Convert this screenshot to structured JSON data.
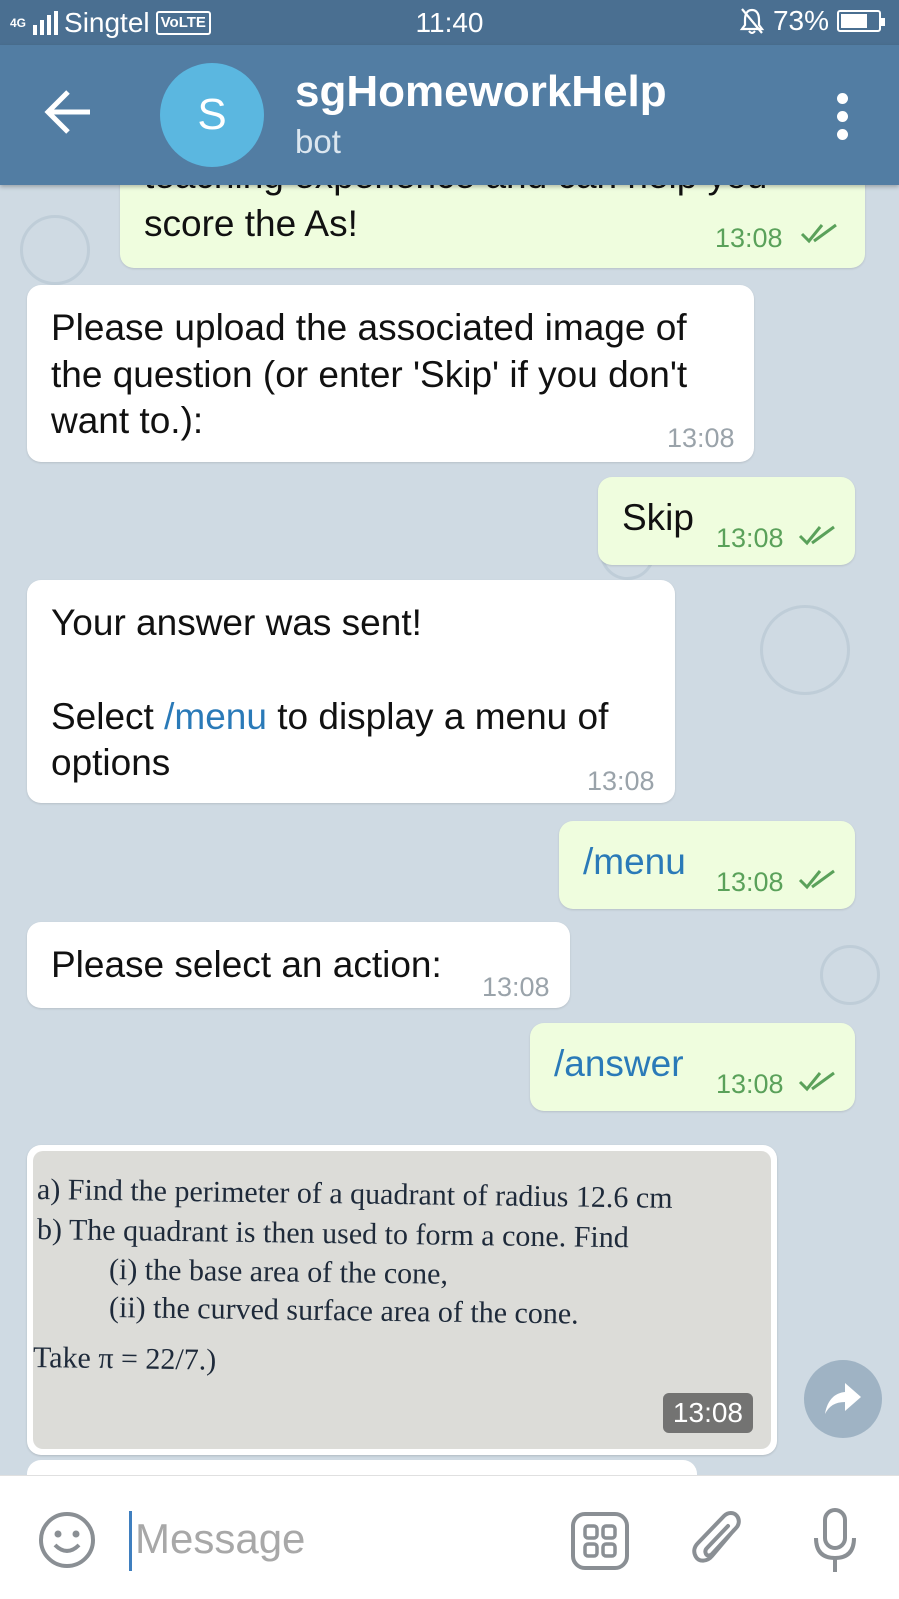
{
  "status_bar": {
    "network": "4G",
    "carrier": "Singtel",
    "volte": "VoLTE",
    "time": "11:40",
    "battery": "73%",
    "battery_level": 0.73
  },
  "header": {
    "avatar_letter": "S",
    "title": "sgHomeworkHelp",
    "subtitle": "bot",
    "colors": {
      "header": "#527da3",
      "status": "#4a6f91",
      "avatar": "#5bb7e0"
    }
  },
  "messages": {
    "m0": {
      "text": "score the As!",
      "cut_text": "teaching experience and can help you",
      "time": "13:08"
    },
    "m1": {
      "line1": "Please upload the associated image of",
      "line2": "the question (or enter 'Skip' if you don't",
      "line3": "want to.):",
      "time": "13:08"
    },
    "m2": {
      "text": "Skip",
      "time": "13:08"
    },
    "m3": {
      "line1": "Your answer was sent!",
      "line2_pre": "Select ",
      "line2_link": "/menu",
      "line2_post": " to display a menu of",
      "line3": "options",
      "time": "13:08"
    },
    "m4": {
      "text": "/menu",
      "time": "13:08"
    },
    "m5": {
      "text": "Please select an action:",
      "time": "13:08"
    },
    "m6": {
      "text": "/answer",
      "time": "13:08"
    },
    "m7": {
      "photo_lines": [
        "a)   Find the perimeter of a quadrant of radius 12.6 cm",
        "b)   The quadrant is then used to form a cone. Find",
        "(i)     the base area of the cone,",
        "(ii)    the curved surface area of the cone.",
        "Take π = 22/7.)"
      ],
      "time": "13:08"
    }
  },
  "input": {
    "placeholder": "Message"
  }
}
